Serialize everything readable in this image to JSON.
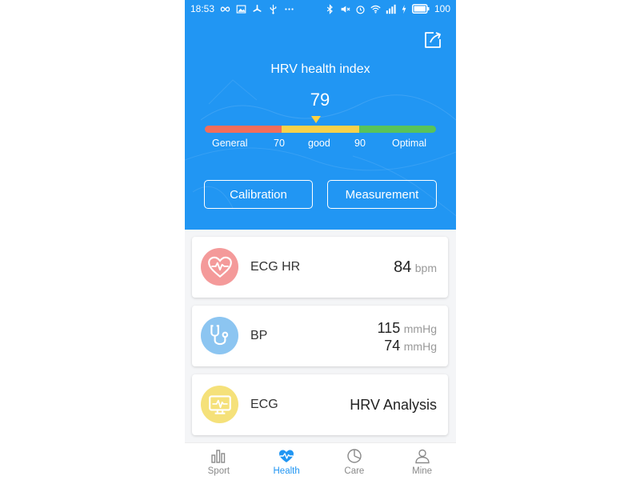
{
  "status_bar": {
    "time": "18:53",
    "battery": "100",
    "left_icons": [
      "infinity-icon",
      "image-icon",
      "fan-icon",
      "usb-icon",
      "more-dots-icon"
    ],
    "right_icons": [
      "bluetooth-icon",
      "mute-icon",
      "alarm-icon",
      "wifi-icon",
      "signal-icon",
      "charging-icon",
      "battery-icon"
    ]
  },
  "header": {
    "share_icon": "share-icon",
    "title": "HRV health index",
    "value": "79",
    "scale": {
      "value_fraction": 0.48,
      "segments": [
        "#f26d5b",
        "#f7d14a",
        "#58c35a"
      ],
      "labels": {
        "general": "General",
        "t70": "70",
        "good": "good",
        "t90": "90",
        "optimal": "Optimal"
      }
    },
    "buttons": {
      "calibration": "Calibration",
      "measurement": "Measurement"
    }
  },
  "cards": {
    "ecg_hr": {
      "icon": "heart-icon",
      "icon_bg": "#f49a9a",
      "label": "ECG HR",
      "value": "84",
      "unit": "bpm"
    },
    "bp": {
      "icon": "stethoscope-icon",
      "icon_bg": "#8cc5f1",
      "label": "BP",
      "systolic": "115",
      "diastolic": "74",
      "unit": "mmHg"
    },
    "ecg": {
      "icon": "monitor-icon",
      "icon_bg": "#f5e17a",
      "label": "ECG",
      "value": "HRV Analysis"
    }
  },
  "tabbar": {
    "accent": "#2196f3",
    "tabs": [
      {
        "label": "Sport",
        "icon": "bar-chart-icon"
      },
      {
        "label": "Health",
        "icon": "heartbeat-icon",
        "active": true
      },
      {
        "label": "Care",
        "icon": "pie-chart-icon"
      },
      {
        "label": "Mine",
        "icon": "user-icon"
      }
    ]
  }
}
